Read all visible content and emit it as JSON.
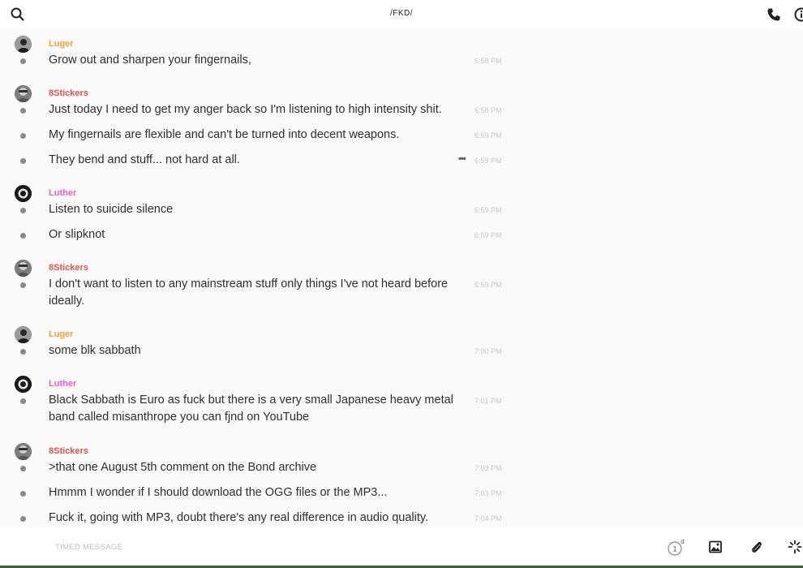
{
  "header": {
    "title": "/FKD/"
  },
  "colors": {
    "luger": "#f0a040",
    "stickers": "#d9534f",
    "luther": "#e061c8"
  },
  "messages": [
    {
      "sender": "Luger",
      "color": "luger",
      "items": [
        {
          "text": "Grow out and sharpen your fingernails,",
          "time": "6:58 PM"
        }
      ]
    },
    {
      "sender": "8Stickers",
      "color": "stickers",
      "items": [
        {
          "text": "Just today I need to get my anger back so I'm listening to high intensity shit.",
          "time": "6:58 PM"
        },
        {
          "text": "My fingernails are flexible and can't be turned into decent weapons.",
          "time": "6:59 PM"
        },
        {
          "text": "They bend and stuff... not hard at all.",
          "time": "6:59 PM"
        }
      ]
    },
    {
      "sender": "Luther",
      "color": "luther",
      "items": [
        {
          "text": "Listen to suicide silence",
          "time": "6:59 PM"
        },
        {
          "text": "Or slipknot",
          "time": "6:59 PM"
        }
      ]
    },
    {
      "sender": "8Stickers",
      "color": "stickers",
      "items": [
        {
          "text": "I don't want to listen to any mainstream stuff only things I've not heard before ideally.",
          "time": "6:59 PM"
        }
      ]
    },
    {
      "sender": "Luger",
      "color": "luger",
      "items": [
        {
          "text": "some blk sabbath",
          "time": "7:00 PM"
        }
      ]
    },
    {
      "sender": "Luther",
      "color": "luther",
      "items": [
        {
          "text": "Black Sabbath is Euro as fuck but there is a very small Japanese heavy metal band called misanthrope you can fjnd on YouTube",
          "time": "7:01 PM"
        }
      ]
    },
    {
      "sender": "8Stickers",
      "color": "stickers",
      "items": [
        {
          "text": ">that one August 5th comment on the Bond archive",
          "time": "7:03 PM"
        },
        {
          "text": "Hmmm I wonder if I should download the OGG files or the MP3...",
          "time": "7:03 PM"
        },
        {
          "text": "Fuck it, going with MP3, doubt there's any real difference in audio quality.",
          "time": "7:04 PM"
        }
      ]
    }
  ],
  "composer": {
    "placeholder": "TIMED MESSAGE",
    "timer_value": "1",
    "timer_unit": "d"
  },
  "icons": {
    "search": "search-icon",
    "phone": "phone-icon",
    "info": "info-icon",
    "timer": "timer-icon",
    "image": "image-icon",
    "attach": "paperclip-icon",
    "send": "spinner-icon"
  }
}
